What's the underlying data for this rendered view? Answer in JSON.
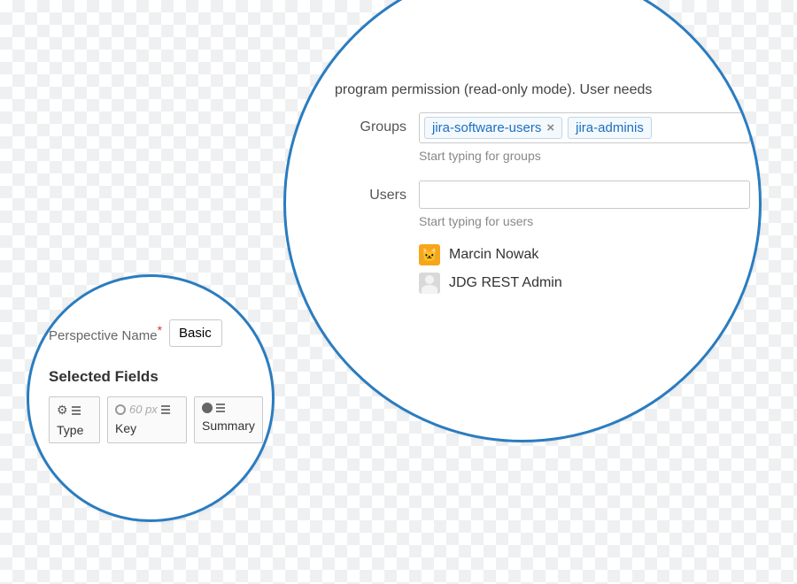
{
  "colors": {
    "accent": "#2a7cc0"
  },
  "large_bubble": {
    "permission_text": "program permission (read-only mode). User needs",
    "groups_label": "Groups",
    "groups_tags": [
      {
        "name": "jira-software-users",
        "removable": true
      },
      {
        "name": "jira-adminis",
        "removable": false
      }
    ],
    "groups_hint": "Start typing for groups",
    "users_label": "Users",
    "users_value": "",
    "users_hint": "Start typing for users",
    "suggested_users": [
      {
        "name": "Marcin Nowak",
        "avatar": "orange",
        "emoji": "🐱"
      },
      {
        "name": "JDG REST Admin",
        "avatar": "grey",
        "emoji": ""
      }
    ]
  },
  "small_bubble": {
    "perspective_label": "Perspective Name",
    "perspective_required": "*",
    "perspective_value": "Basic",
    "section_title": "Selected Fields",
    "fields": [
      {
        "label": "Type",
        "icon": "gear",
        "width_text": ""
      },
      {
        "label": "Key",
        "icon": "radio-empty",
        "width_text": "60 px"
      },
      {
        "label": "Summary",
        "icon": "radio-filled",
        "width_text": ""
      }
    ]
  }
}
